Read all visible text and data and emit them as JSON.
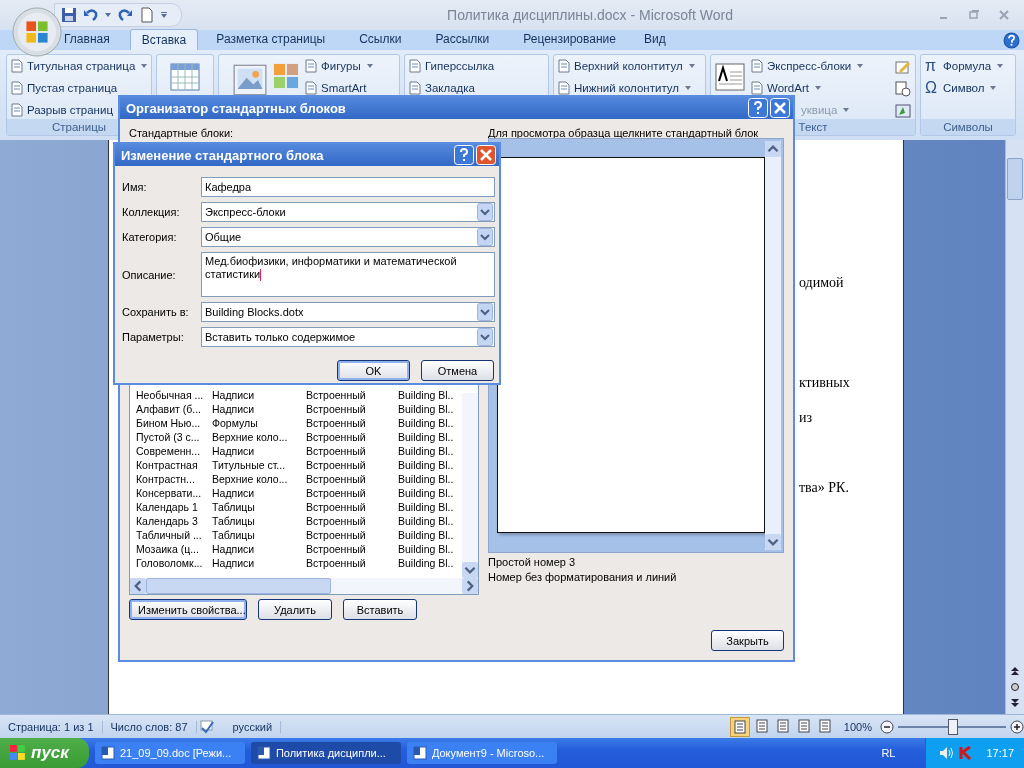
{
  "window": {
    "title": "Политика дисциплины.docx - Microsoft Word"
  },
  "tabs": [
    {
      "label": "Главная",
      "selected": false
    },
    {
      "label": "Вставка",
      "selected": true
    },
    {
      "label": "Разметка страницы",
      "selected": false
    },
    {
      "label": "Ссылки",
      "selected": false
    },
    {
      "label": "Рассылки",
      "selected": false
    },
    {
      "label": "Рецензирование",
      "selected": false
    },
    {
      "label": "Вид",
      "selected": false
    }
  ],
  "ribbon": {
    "groups": [
      {
        "kind": "pages",
        "label": "Страницы",
        "items": [
          {
            "text": "Титульная страница",
            "dropdown": true,
            "disabled": false
          },
          {
            "text": "Пустая страница",
            "dropdown": false,
            "disabled": false
          },
          {
            "text": "Разрыв страниц",
            "dropdown": false,
            "disabled": false
          }
        ]
      },
      {
        "kind": "table"
      },
      {
        "kind": "illustrations",
        "items": [
          {
            "text": "Фигуры",
            "dropdown": true,
            "disabled": false
          },
          {
            "text": "SmartArt",
            "dropdown": false,
            "disabled": false
          }
        ]
      },
      {
        "kind": "links",
        "items": [
          {
            "text": "Гиперссылка",
            "dropdown": false,
            "disabled": false
          },
          {
            "text": "Закладка",
            "dropdown": false,
            "disabled": false
          }
        ]
      },
      {
        "kind": "headers",
        "items": [
          {
            "text": "Верхний колонтитул",
            "dropdown": true,
            "disabled": false
          },
          {
            "text": "Нижний колонтитул",
            "dropdown": true,
            "disabled": false
          }
        ]
      },
      {
        "kind": "text",
        "label": "Текст",
        "items": [
          {
            "text": "Экспресс-блоки",
            "dropdown": true,
            "disabled": false
          },
          {
            "text": "WordArt",
            "dropdown": true,
            "disabled": false
          },
          {
            "text": "уквица",
            "dropdown": true,
            "disabled": true
          }
        ]
      },
      {
        "kind": "symbols",
        "label": "Символы",
        "items": [
          {
            "symbol": "π",
            "text": "Формула",
            "dropdown": true,
            "disabled": false
          },
          {
            "symbol": "Ω",
            "text": "Символ",
            "dropdown": true,
            "disabled": false
          }
        ]
      }
    ]
  },
  "document": {
    "fragments": [
      "одимой",
      "ктивных",
      "из",
      "тва» РК."
    ]
  },
  "organizer": {
    "title": "Организатор стандартных блоков",
    "list_label": "Стандартные блоки:",
    "preview_label": "Для просмотра образца щелкните стандартный блок",
    "rows": [
      {
        "cells": [
          "Необычная ...",
          "Надписи",
          "Встроенный",
          "Building Bl.."
        ]
      },
      {
        "cells": [
          "Алфавит (б...",
          "Надписи",
          "Встроенный",
          "Building Bl.."
        ]
      },
      {
        "cells": [
          "Бином Нью...",
          "Формулы",
          "Встроенный",
          "Building Bl.."
        ]
      },
      {
        "cells": [
          "Пустой (3 с...",
          "Верхние коло...",
          "Встроенный",
          "Building Bl.."
        ]
      },
      {
        "cells": [
          "Современн...",
          "Надписи",
          "Встроенный",
          "Building Bl.."
        ]
      },
      {
        "cells": [
          "Контрастная",
          "Титульные ст...",
          "Встроенный",
          "Building Bl.."
        ]
      },
      {
        "cells": [
          "Контрастн...",
          "Верхние коло...",
          "Встроенный",
          "Building Bl.."
        ]
      },
      {
        "cells": [
          "Консервати...",
          "Надписи",
          "Встроенный",
          "Building Bl.."
        ]
      },
      {
        "cells": [
          "Календарь 1",
          "Таблицы",
          "Встроенный",
          "Building Bl.."
        ]
      },
      {
        "cells": [
          "Календарь 3",
          "Таблицы",
          "Встроенный",
          "Building Bl.."
        ]
      },
      {
        "cells": [
          "Табличный ...",
          "Таблицы",
          "Встроенный",
          "Building Bl.."
        ]
      },
      {
        "cells": [
          "Мозаика (ц...",
          "Надписи",
          "Встроенный",
          "Building Bl.."
        ]
      },
      {
        "cells": [
          "Головоломк...",
          "Надписи",
          "Встроенный",
          "Building Bl.."
        ]
      }
    ],
    "preview_name": "Простой номер 3",
    "preview_description": "Номер без форматирования и линий",
    "buttons": [
      {
        "label": "Изменить свойства...",
        "selected": true
      },
      {
        "label": "Удалить",
        "selected": false
      },
      {
        "label": "Вставить",
        "selected": false
      }
    ],
    "close_button": "Закрыть"
  },
  "edit_dialog": {
    "title": "Изменение стандартного блока",
    "fields": [
      {
        "kind": "text",
        "label": "Имя:",
        "value": "Кафедра"
      },
      {
        "kind": "dropdown",
        "label": "Коллекция:",
        "value": "Экспресс-блоки"
      },
      {
        "kind": "dropdown",
        "label": "Категория:",
        "value": "Общие"
      },
      {
        "kind": "textarea",
        "label": "Описание:",
        "value": "Мед.биофизики, информатики и математической статистики"
      },
      {
        "kind": "dropdown",
        "label": "Сохранить в:",
        "value": "Building Blocks.dotx"
      },
      {
        "kind": "dropdown",
        "label": "Параметры:",
        "value": "Вставить только содержимое"
      }
    ],
    "buttons": [
      {
        "label": "OK",
        "selected": true
      },
      {
        "label": "Отмена",
        "selected": false
      }
    ]
  },
  "status_bar": {
    "page": "Страница: 1 из 1",
    "words": "Число слов: 87",
    "language": "русский",
    "views": [
      {
        "selected": true
      },
      {
        "selected": false
      },
      {
        "selected": false
      },
      {
        "selected": false
      },
      {
        "selected": false
      }
    ],
    "zoom": "100%",
    "zoom_slider": {
      "level": 0.5
    }
  },
  "taskbar": {
    "start": "пуск",
    "tasks": [
      {
        "label": "21_09_09.doc [Режи...",
        "selected": false
      },
      {
        "label": "Политика дисципли...",
        "selected": true
      },
      {
        "label": "Документ9 - Microso...",
        "selected": false
      }
    ],
    "language": "RL",
    "clock": "17:17"
  }
}
